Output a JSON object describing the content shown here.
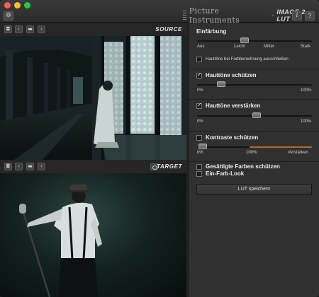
{
  "titlebar": {
    "app_name": "Picture Instruments",
    "separator": "-",
    "product": "IMAGE 2 LUT",
    "info_glyph": "i",
    "help_glyph": "?",
    "gear_glyph": "⚙"
  },
  "source": {
    "label": "SOURCE",
    "toolbar_icons": [
      "camera-icon",
      "prev-icon",
      "folder-icon",
      "next-icon"
    ]
  },
  "target": {
    "label": "TARGET",
    "toolbar_icons": [
      "camera-icon",
      "prev-icon",
      "folder-icon",
      "next-icon",
      "eye-icon"
    ]
  },
  "panel": {
    "tint": {
      "title": "Einfärbung",
      "labels": [
        "Aus",
        "Leicht",
        "Mittel",
        "Stark"
      ],
      "exclude_skin_label": "Hauttöne bei Farbberechnung ausschließen",
      "exclude_skin_checked": false
    },
    "protect_skin": {
      "label": "Hauttöne schützen",
      "checked": true,
      "min_label": "0%",
      "max_label": "100%"
    },
    "enhance_skin": {
      "label": "Hauttöne verstärken",
      "checked": true,
      "min_label": "0%",
      "max_label": "100%"
    },
    "protect_contrast": {
      "label": "Kontraste schützen",
      "checked": false,
      "labels": [
        "0%",
        "100%",
        "Verstärken"
      ]
    },
    "protect_saturated": {
      "label": "Gesättigte Farben schützen",
      "checked": false
    },
    "mono_look": {
      "label": "Ein-Farb-Look",
      "checked": false
    },
    "save_label": "LUT speichern"
  },
  "colors": {
    "panel_bg": "#303030",
    "accent_orange": "#c4641e"
  }
}
